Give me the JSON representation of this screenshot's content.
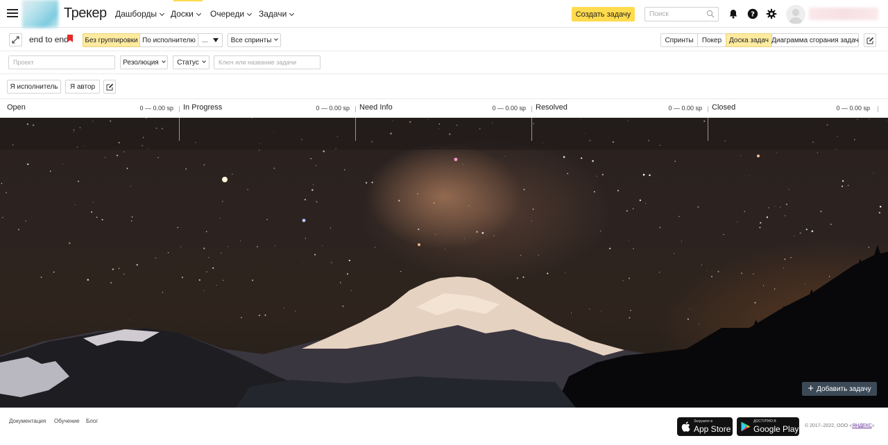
{
  "header": {
    "logo_text": "Трекер",
    "nav": [
      {
        "label": "Дашборды"
      },
      {
        "label": "Доски"
      },
      {
        "label": "Очереди"
      },
      {
        "label": "Задачи"
      }
    ],
    "create_button": "Создать задачу",
    "search_placeholder": "Поиск"
  },
  "toolbar": {
    "board_title": "end to end",
    "grouping": [
      "Без группировки",
      "По исполнителю",
      "..."
    ],
    "sprints_dropdown": "Все спринты",
    "views": [
      "Спринты",
      "Покер",
      "Доска задач",
      "Диаграмма сгорания задач"
    ],
    "active_view": "Доска задач"
  },
  "filters": {
    "project_placeholder": "Проект",
    "resolution": "Резолюция",
    "status": "Статус",
    "key_placeholder": "Ключ или название задачи"
  },
  "quick_filters": {
    "assignee": "Я исполнитель",
    "author": "Я автор"
  },
  "board": {
    "columns": [
      {
        "title": "Open",
        "sp": "0 — 0.00 sp"
      },
      {
        "title": "In Progress",
        "sp": "0 — 0.00 sp"
      },
      {
        "title": "Need Info",
        "sp": "0 — 0.00 sp"
      },
      {
        "title": "Resolved",
        "sp": "0 — 0.00 sp"
      },
      {
        "title": "Closed",
        "sp": "0 — 0.00 sp"
      }
    ],
    "add_task": "Добавить задачу"
  },
  "footer": {
    "links": [
      "Документация",
      "Обучение",
      "Блог"
    ],
    "app_store_small": "Загрузите в",
    "app_store": "App Store",
    "google_play_small": "ДОСТУПНО В",
    "google_play": "Google Play",
    "copyright": "© 2017–2022, ООО «",
    "copyright_brand": "ЯНДЕКС",
    "copyright_end": "»"
  },
  "colors": {
    "accent_yellow": "#ffdb4d",
    "selected_button": "#ffeba0",
    "add_task_bg": "#3c4a57",
    "bookmark_red": "#e52b2b"
  }
}
